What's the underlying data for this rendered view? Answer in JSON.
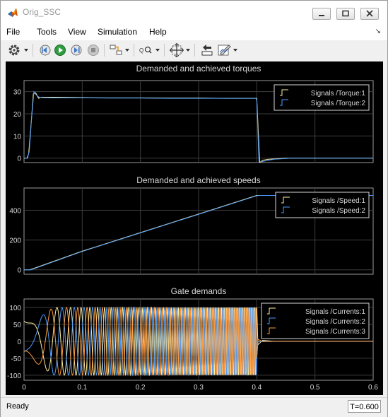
{
  "window": {
    "title": "Orig_SSC"
  },
  "menu": {
    "items": [
      "File",
      "Tools",
      "View",
      "Simulation",
      "Help"
    ]
  },
  "toolbar": {
    "icons": [
      "settings-icon",
      "step-back-icon",
      "run-icon",
      "step-forward-icon",
      "stop-icon",
      "highlight-block-icon",
      "zoom-icon",
      "fit-to-view-icon",
      "cursor-measurement-icon",
      "style-icon"
    ]
  },
  "status": {
    "text": "Ready",
    "time": "T=0.600"
  },
  "colors": {
    "scope_background": "#000000",
    "axes_background": "#000000",
    "axes_foreground": "#d8d8d8",
    "grid": "#3c3c3c",
    "series_yellow": "#fff0a0",
    "series_blue": "#4d9dff",
    "series_orange": "#ff9a3c"
  },
  "chart_data": [
    {
      "type": "line",
      "title": "Demanded and achieved torques",
      "xlim": [
        0,
        0.6
      ],
      "ylim": [
        -2,
        35
      ],
      "yticks": [
        0,
        10,
        20,
        30
      ],
      "xtick_labels_visible": false,
      "grid": true,
      "legend_placement": "top-right",
      "series": [
        {
          "name": "Signals /Torque:1",
          "color": "#fff0a0",
          "points": [
            [
              0,
              0
            ],
            [
              0.005,
              0
            ],
            [
              0.008,
              2
            ],
            [
              0.012,
              15
            ],
            [
              0.016,
              29
            ],
            [
              0.02,
              29.5
            ],
            [
              0.025,
              27
            ],
            [
              0.03,
              27.5
            ],
            [
              0.05,
              27.5
            ],
            [
              0.1,
              27.3
            ],
            [
              0.15,
              27.2
            ],
            [
              0.2,
              27.2
            ],
            [
              0.25,
              27.1
            ],
            [
              0.3,
              27.1
            ],
            [
              0.35,
              27
            ],
            [
              0.398,
              27
            ],
            [
              0.4,
              27
            ],
            [
              0.405,
              -2
            ],
            [
              0.41,
              -1
            ],
            [
              0.42,
              -0.5
            ],
            [
              0.45,
              0
            ],
            [
              0.6,
              0
            ]
          ]
        },
        {
          "name": "Signals /Torque:2",
          "color": "#4d9dff",
          "points": [
            [
              0,
              0
            ],
            [
              0.006,
              0
            ],
            [
              0.009,
              3
            ],
            [
              0.013,
              18
            ],
            [
              0.017,
              30
            ],
            [
              0.021,
              28.5
            ],
            [
              0.026,
              27.5
            ],
            [
              0.03,
              27.3
            ],
            [
              0.05,
              27.2
            ],
            [
              0.1,
              27.2
            ],
            [
              0.15,
              27.1
            ],
            [
              0.2,
              27.1
            ],
            [
              0.25,
              27
            ],
            [
              0.3,
              27
            ],
            [
              0.35,
              27
            ],
            [
              0.399,
              27
            ],
            [
              0.4,
              26
            ],
            [
              0.404,
              -3
            ],
            [
              0.41,
              -1.5
            ],
            [
              0.43,
              -0.5
            ],
            [
              0.46,
              0
            ],
            [
              0.6,
              0
            ]
          ]
        }
      ]
    },
    {
      "type": "line",
      "title": "Demanded and achieved speeds",
      "xlim": [
        0,
        0.6
      ],
      "ylim": [
        -30,
        550
      ],
      "yticks": [
        0,
        200,
        400
      ],
      "xtick_labels_visible": false,
      "grid": true,
      "legend_placement": "top-right",
      "series": [
        {
          "name": "Signals /Speed:1",
          "color": "#fff0a0",
          "points": [
            [
              0,
              0
            ],
            [
              0.01,
              0
            ],
            [
              0.1,
              125
            ],
            [
              0.2,
              250
            ],
            [
              0.3,
              375
            ],
            [
              0.4,
              500
            ],
            [
              0.6,
              500
            ]
          ]
        },
        {
          "name": "Signals /Speed:2",
          "color": "#4d9dff",
          "points": [
            [
              0,
              0
            ],
            [
              0.012,
              0
            ],
            [
              0.1,
              123
            ],
            [
              0.2,
              248
            ],
            [
              0.3,
              373
            ],
            [
              0.4,
              498
            ],
            [
              0.405,
              500
            ],
            [
              0.6,
              500
            ]
          ]
        }
      ]
    },
    {
      "type": "line",
      "title": "Gate demands",
      "xlim": [
        0,
        0.6
      ],
      "ylim": [
        -115,
        125
      ],
      "yticks": [
        -100,
        -50,
        0,
        50,
        100
      ],
      "xticks": [
        0,
        0.1,
        0.2,
        0.3,
        0.4,
        0.5,
        0.6
      ],
      "grid": true,
      "legend_placement": "top-right",
      "series": [
        {
          "name": "Signals /Currents:1",
          "color": "#fff0a0",
          "amplitude": 100,
          "phase_deg": 90
        },
        {
          "name": "Signals /Currents:2",
          "color": "#4d9dff",
          "amplitude": 100,
          "phase_deg": -30
        },
        {
          "name": "Signals /Currents:3",
          "color": "#ff9a3c",
          "amplitude": 100,
          "phase_deg": 210
        }
      ],
      "waveform": {
        "type": "three-phase-chirp",
        "accel_rev_per_s2": 625,
        "duration": 0.4,
        "settled_value": 0
      }
    }
  ]
}
